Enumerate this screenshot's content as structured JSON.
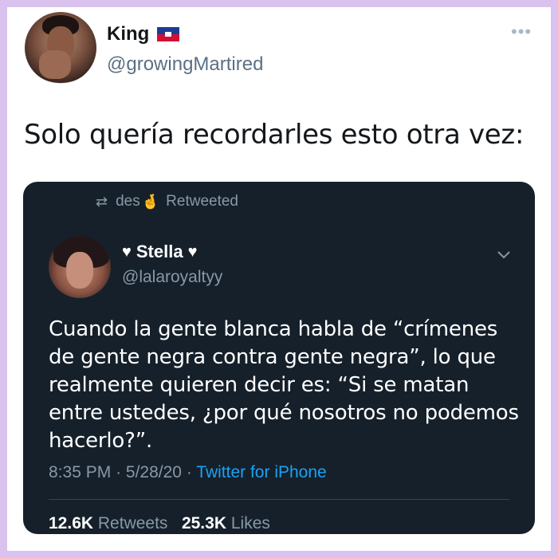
{
  "outer_tweet": {
    "display_name": "King",
    "flag_icon": "haiti-flag-icon",
    "handle": "@growingMartired",
    "more_icon": "more-dots-icon",
    "text": "Solo quería recordarles esto otra vez:"
  },
  "embedded_tweet": {
    "retweet_icon": "retweet-icon",
    "retweeted_by": "des",
    "retweeted_emoji": "🤞",
    "retweeted_label": "Retweeted",
    "heart_left": "♥",
    "display_name": "Stella",
    "heart_right": "♥",
    "handle": "@lalaroyaltyy",
    "chevron_icon": "chevron-down-icon",
    "text": "Cuando la gente blanca habla de “crímenes de gente negra contra gente negra”, lo que realmente quieren decir es: “Si se matan entre ustedes, ¿por qué nosotros no podemos hacerlo?”.",
    "time": "8:35 PM",
    "separator": "·",
    "date": "5/28/20",
    "source": "Twitter for iPhone",
    "retweets_count": "12.6K",
    "retweets_label": "Retweets",
    "likes_count": "25.3K",
    "likes_label": "Likes"
  },
  "colors": {
    "frame_border": "#d9c2ee",
    "card_background": "#15202b",
    "link_blue": "#1da1f2",
    "muted_gray": "#8899a6"
  }
}
